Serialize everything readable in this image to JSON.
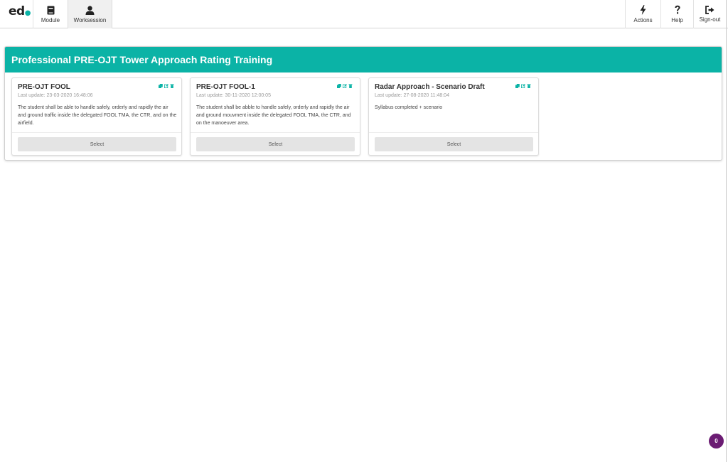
{
  "brand": {
    "logo_text": "ed",
    "accent": "#0bb3a6"
  },
  "nav": {
    "module_label": "Module",
    "worksession_label": "Worksession",
    "actions_label": "Actions",
    "help_label": "Help",
    "signout_label": "Sign-out"
  },
  "panel": {
    "title": "Professional PRE-OJT Tower Approach Rating Training"
  },
  "cards": [
    {
      "title": "PRE-OJT FOOL",
      "last_update": "Last update: 23-03-2020 16:48:06",
      "description": "The student shall be able to handle safely, orderly and rapidly the air and ground traffic inside the delegated FOOL TMA, the CTR, and on the airfield.",
      "select_label": "Select"
    },
    {
      "title": "PRE-OJT FOOL-1",
      "last_update": "Last update: 30-11-2020 12:00:05",
      "description": "The student shall be abble to handle safely, orderly and rapidly the air and ground mouvment inside the delegated FOOL TMA, the CTR, and on the manoeuver area.",
      "select_label": "Select"
    },
    {
      "title": "Radar Approach - Scenario Draft",
      "last_update": "Last update: 27-08-2020 11:48:04",
      "description": "Syllabus completed + scenario",
      "select_label": "Select"
    }
  ],
  "notification_count": "0",
  "colors": {
    "badge": "#6b1c73",
    "header": "#0bb3a6"
  }
}
